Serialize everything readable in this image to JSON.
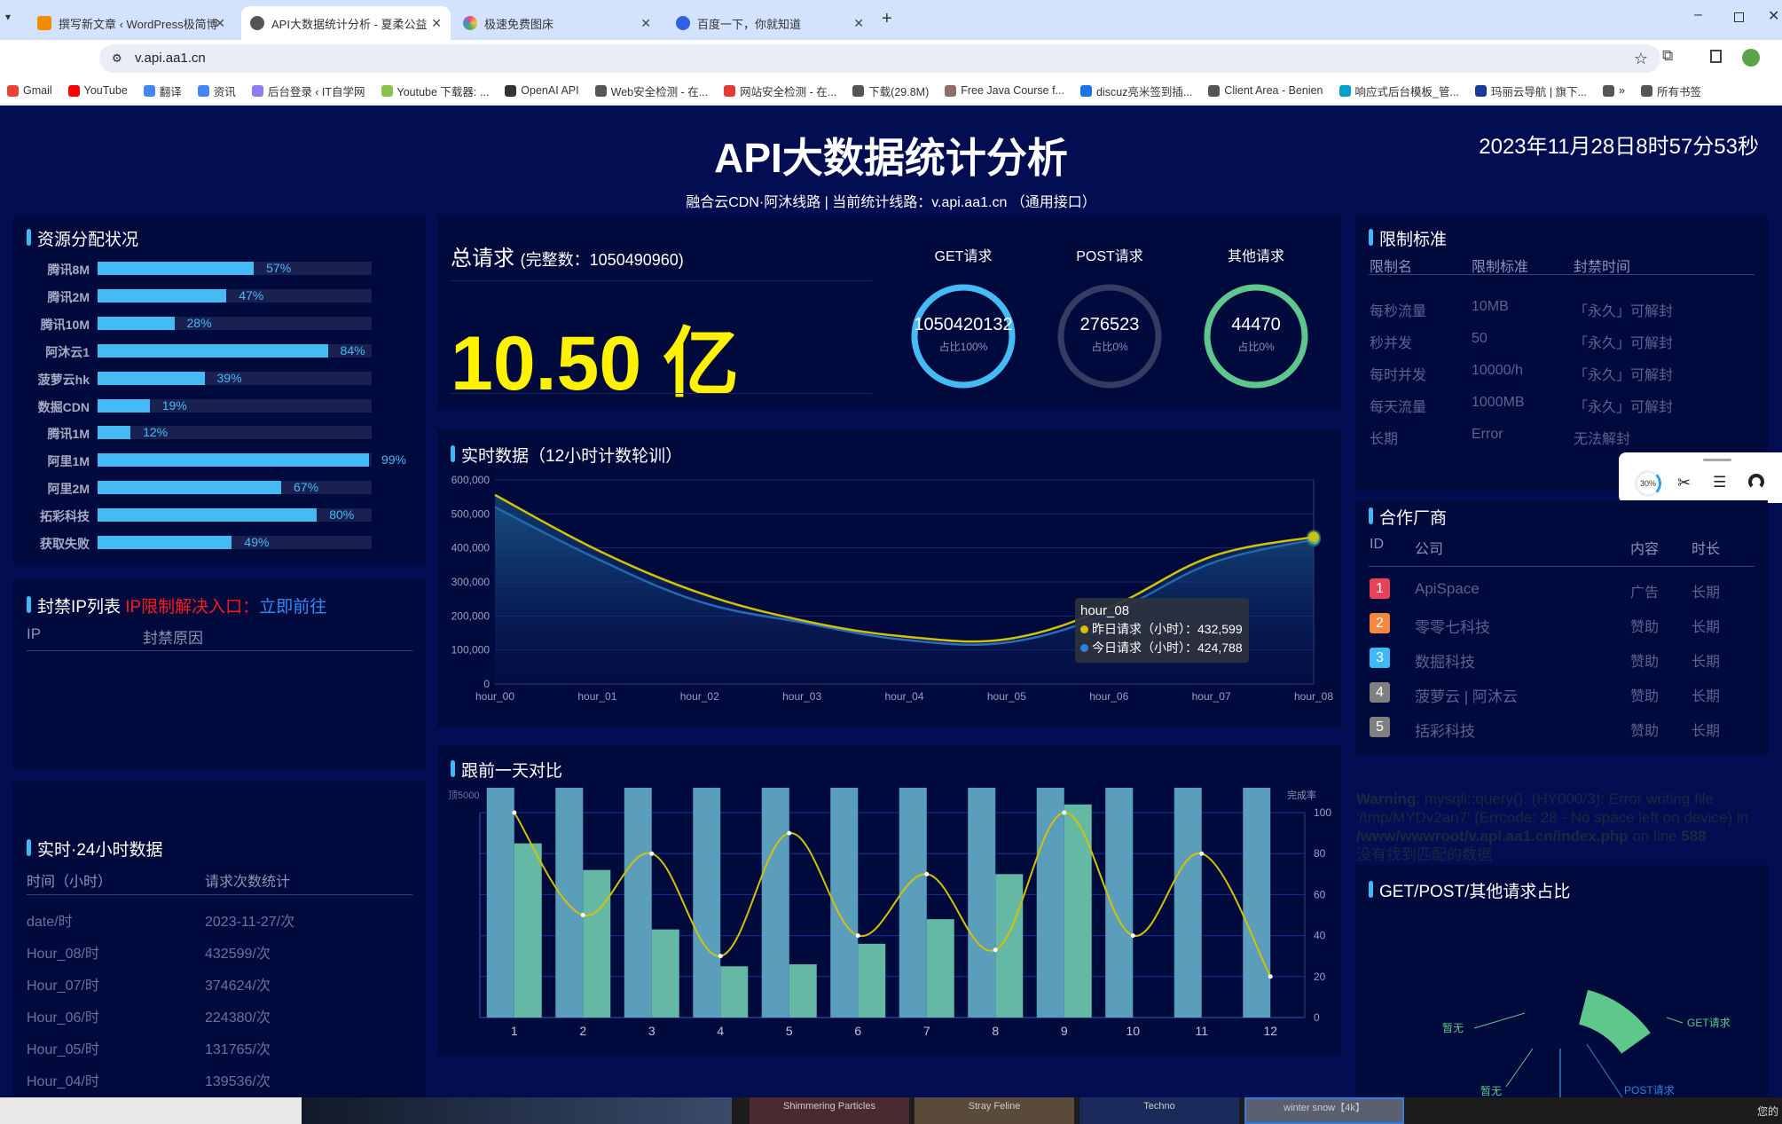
{
  "browser": {
    "tabs": [
      {
        "label": "撰写新文章 ‹ WordPress极简博",
        "color": "#f28c00"
      },
      {
        "label": "API大数据统计分析 - 夏柔公益",
        "color": "#555555"
      },
      {
        "label": "极速免费图床",
        "color": "#e94e77"
      },
      {
        "label": "百度一下，你就知道",
        "color": "#3060e0"
      }
    ],
    "new_tab": "+",
    "url": "v.api.aa1.cn",
    "bookmarks": [
      "Gmail",
      "YouTube",
      "翻译",
      "资讯",
      "后台登录 ‹ IT自学网",
      "Youtube 下载器: ...",
      "OpenAI API",
      "Web安全检测 - 在...",
      "网站安全检测 - 在...",
      "下载(29.8M)",
      "Free Java Course f...",
      "discuz亮米签到插...",
      "Client Area - Benien",
      "响应式后台模板_管...",
      "玛丽云导航 | 旗下...",
      "»",
      "所有书签"
    ]
  },
  "header": {
    "title": "API大数据统计分析",
    "subtitle": "融合云CDN·阿沐线路 | 当前统计线路：v.api.aa1.cn （通用接口）",
    "datetime": "2023年11月28日8时57分53秒"
  },
  "resources": {
    "title": "资源分配状况",
    "items": [
      {
        "label": "腾讯8M",
        "pct": 57
      },
      {
        "label": "腾讯2M",
        "pct": 47
      },
      {
        "label": "腾讯10M",
        "pct": 28
      },
      {
        "label": "阿沐云1",
        "pct": 84
      },
      {
        "label": "菠萝云hk",
        "pct": 39
      },
      {
        "label": "数掘CDN",
        "pct": 19
      },
      {
        "label": "腾讯1M",
        "pct": 12
      },
      {
        "label": "阿里1M",
        "pct": 99
      },
      {
        "label": "阿里2M",
        "pct": 67
      },
      {
        "label": "拓彩科技",
        "pct": 80
      },
      {
        "label": "获取失败",
        "pct": 49
      }
    ]
  },
  "ban_list": {
    "title": "封禁IP列表",
    "notice": "IP限制解决入口：",
    "link": "立即前往",
    "columns": [
      "IP",
      "封禁原因"
    ]
  },
  "hourly": {
    "title": "实时·24小时数据",
    "columns": [
      "时间（小时）",
      "请求次数统计"
    ],
    "rows": [
      [
        "date/时",
        "2023-11-27/次"
      ],
      [
        "Hour_08/时",
        "432599/次"
      ],
      [
        "Hour_07/时",
        "374624/次"
      ],
      [
        "Hour_06/时",
        "224380/次"
      ],
      [
        "Hour_05/时",
        "131765/次"
      ],
      [
        "Hour_04/时",
        "139536/次"
      ]
    ]
  },
  "total": {
    "label": "总请求",
    "full_count": "(完整数：1050490960)",
    "big_value": "10.50 亿",
    "gauges": [
      {
        "label": "GET请求",
        "value": "1050420132",
        "ratio": "占比100%",
        "fraction": 1.0,
        "color": "#45bbf6"
      },
      {
        "label": "POST请求",
        "value": "276523",
        "ratio": "占比0%",
        "fraction": 0,
        "color": "#353c62"
      },
      {
        "label": "其他请求",
        "value": "44470",
        "ratio": "占比0%",
        "fraction": 1.0,
        "color": "#5ec78b"
      }
    ]
  },
  "limits": {
    "title": "限制标准",
    "columns": [
      "限制名",
      "限制标准",
      "封禁时间"
    ],
    "rows": [
      [
        "每秒流量",
        "10MB",
        "「永久」可解封"
      ],
      [
        "秒并发",
        "50",
        "「永久」可解封"
      ],
      [
        "每时并发",
        "10000/h",
        "「永久」可解封"
      ],
      [
        "每天流量",
        "1000MB",
        "「永久」可解封"
      ],
      [
        "长期",
        "Error",
        "无法解封"
      ]
    ]
  },
  "widget": {
    "progress": "30%"
  },
  "partners": {
    "title": "合作厂商",
    "columns": [
      "ID",
      "公司",
      "内容",
      "时长"
    ],
    "rows": [
      {
        "id": "1",
        "company": "ApiSpace",
        "content": "广告",
        "duration": "长期",
        "color": "#e8425a"
      },
      {
        "id": "2",
        "company": "零零七科技",
        "content": "赞助",
        "duration": "长期",
        "color": "#f5883d"
      },
      {
        "id": "3",
        "company": "数掘科技",
        "content": "赞助",
        "duration": "长期",
        "color": "#3fb8f5"
      },
      {
        "id": "4",
        "company": "菠萝云 | 阿沐云",
        "content": "赞助",
        "duration": "长期",
        "color": "#7f7f7f"
      },
      {
        "id": "5",
        "company": "括彩科技",
        "content": "赞助",
        "duration": "长期",
        "color": "#7f7f7f"
      }
    ]
  },
  "warning": {
    "label": "Warning",
    "line1": ": mysqli::query(): (HY000/3): Error writing file",
    "line2": "'/tmp/MYDv2an7' (Errcode: 28 - No space left on device) in",
    "path": "/www/wwwroot/v.api.aa1.cn/index.php",
    "online": " on line ",
    "lineno": "588",
    "nodata": "没有找到匹配的数据"
  },
  "taskbar": {
    "items": [
      "Shimmering Particles",
      "Stray Feline",
      "Techno",
      "winter snow【4k】"
    ],
    "right": "您的"
  },
  "chart_data": [
    {
      "type": "line",
      "title": "实时数据（12小时计数轮训）",
      "categories": [
        "hour_00",
        "hour_01",
        "hour_02",
        "hour_03",
        "hour_04",
        "hour_05",
        "hour_06",
        "hour_07",
        "hour_08"
      ],
      "series": [
        {
          "name": "昨日请求（小时）",
          "color": "#d4c200",
          "values": [
            556000,
            394000,
            268000,
            187000,
            139536,
            131765,
            224380,
            374624,
            432599
          ]
        },
        {
          "name": "今日请求（小时）",
          "color": "#2f80d8",
          "values": [
            520000,
            368000,
            242000,
            181000,
            130000,
            122000,
            207000,
            355000,
            424788
          ]
        }
      ],
      "ylim": [
        0,
        600000
      ],
      "yticks": [
        "0",
        "100,000",
        "200,000",
        "300,000",
        "400,000",
        "500,000",
        "600,000"
      ],
      "grid": true,
      "tooltip": {
        "title": "hour_08",
        "lines": [
          "昨日请求（小时）：432,599",
          "今日请求（小时）：424,788"
        ]
      }
    },
    {
      "type": "bar",
      "title": "跟前一天对比",
      "categories": [
        "1",
        "2",
        "3",
        "4",
        "5",
        "6",
        "7",
        "8",
        "9",
        "10",
        "11",
        "12"
      ],
      "left_axis_label": "顶5000",
      "right_axis_label": "完成率",
      "right_ylim": [
        0,
        100
      ],
      "right_yticks": [
        "0",
        "20",
        "40",
        "60",
        "80",
        "100"
      ],
      "series": [
        {
          "type": "bar",
          "axis": "left",
          "color": "#5b9ebb",
          "values": [
            5000,
            5000,
            5000,
            5000,
            5000,
            5000,
            5000,
            5000,
            5000,
            5000,
            5000,
            5000
          ]
        },
        {
          "type": "bar",
          "axis": "right",
          "color": "#64b8a4",
          "values": [
            85,
            72,
            43,
            25,
            26,
            36,
            48,
            70,
            104,
            0,
            0,
            0
          ]
        },
        {
          "type": "line",
          "axis": "right",
          "color": "#d4c200",
          "values": [
            100,
            50,
            80,
            30,
            90,
            40,
            70,
            33,
            100,
            40,
            80,
            20
          ]
        }
      ],
      "left_ylim": [
        0,
        5000
      ],
      "grid": true
    },
    {
      "type": "pie",
      "title": "GET/POST/其他请求占比",
      "labels": [
        "GET请求",
        "POST请求",
        "暂无",
        "暂无"
      ],
      "colors": [
        "#5ec78b",
        "#2f80d8",
        "#5ec78b",
        "#5ec78b"
      ]
    }
  ]
}
